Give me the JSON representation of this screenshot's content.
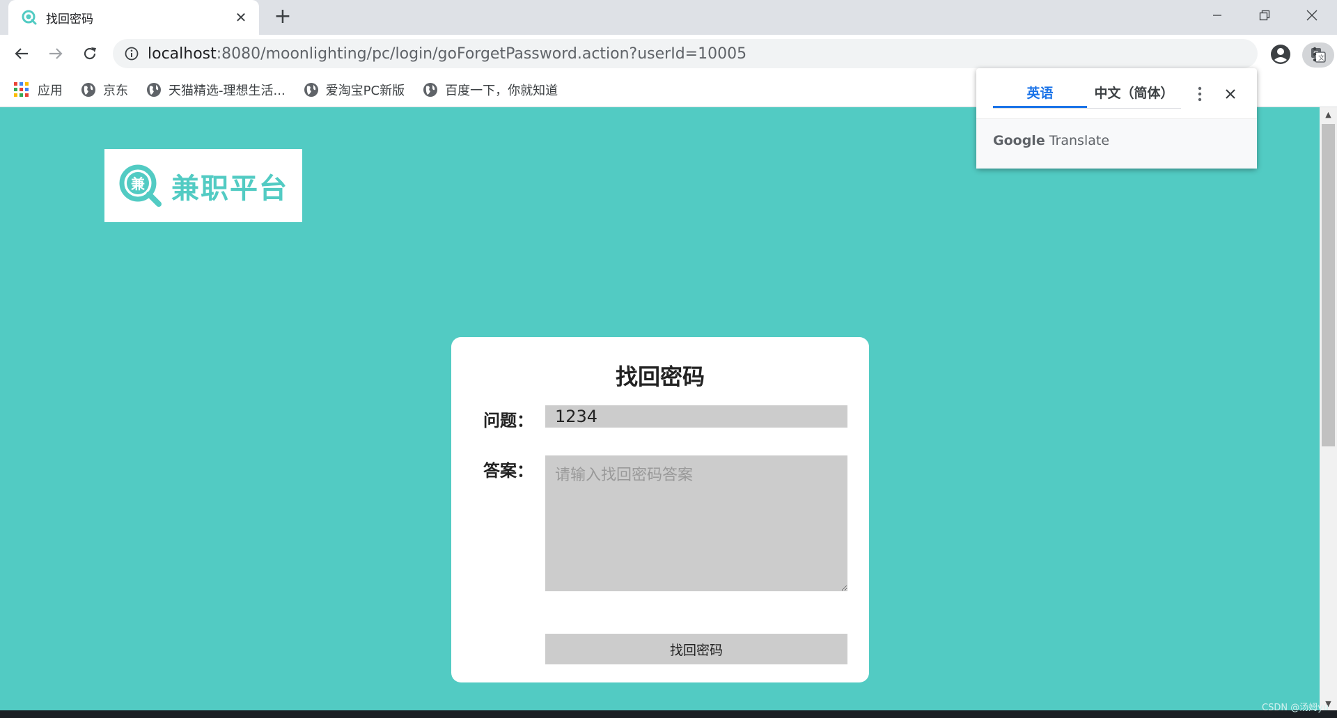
{
  "browser": {
    "tab": {
      "title": "找回密码",
      "close_glyph": "✕"
    },
    "new_tab_glyph": "+",
    "address_bar": {
      "host": "localhost",
      "rest": ":8080/moonlighting/pc/login/goForgetPassword.action?userId=10005"
    },
    "bookmarks": [
      {
        "label": "应用",
        "icon": "apps-icon"
      },
      {
        "label": "京东",
        "icon": "globe-icon"
      },
      {
        "label": "天猫精选-理想生活...",
        "icon": "globe-icon"
      },
      {
        "label": "爱淘宝PC新版",
        "icon": "globe-icon"
      },
      {
        "label": "百度一下，你就知道",
        "icon": "globe-icon"
      }
    ],
    "translate_popup": {
      "tabs": [
        {
          "label": "英语",
          "active": true
        },
        {
          "label": "中文（简体）",
          "active": false
        }
      ],
      "brand_google": "Google",
      "brand_translate": " Translate"
    }
  },
  "page": {
    "logo_text": "兼职平台",
    "logo_badge": "兼",
    "form": {
      "title": "找回密码",
      "question_label": "问题：",
      "question_value": "1234",
      "answer_label": "答案：",
      "answer_placeholder": "请输入找回密码答案",
      "submit_label": "找回密码"
    },
    "watermark": "CSDN @汤姆yu"
  },
  "colors": {
    "page_bg": "#52cbc3",
    "accent_blue": "#1a73e8",
    "input_bg": "#cccccc"
  }
}
